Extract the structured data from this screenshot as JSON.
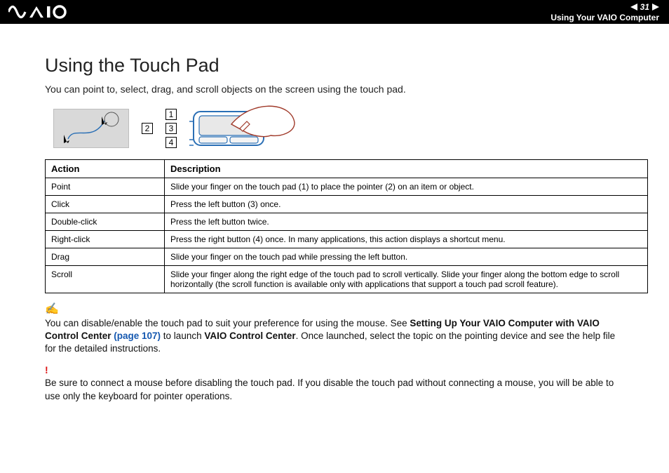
{
  "header": {
    "page_number": "31",
    "section": "Using Your VAIO Computer"
  },
  "title": "Using the Touch Pad",
  "intro": "You can point to, select, drag, and scroll objects on the screen using the touch pad.",
  "callouts": {
    "c1": "1",
    "c2": "2",
    "c3": "3",
    "c4": "4"
  },
  "table": {
    "headers": {
      "action": "Action",
      "description": "Description"
    },
    "rows": [
      {
        "action": "Point",
        "description": "Slide your finger on the touch pad (1) to place the pointer (2) on an item or object."
      },
      {
        "action": "Click",
        "description": "Press the left button (3) once."
      },
      {
        "action": "Double-click",
        "description": "Press the left button twice."
      },
      {
        "action": "Right-click",
        "description": "Press the right button (4) once. In many applications, this action displays a shortcut menu."
      },
      {
        "action": "Drag",
        "description": "Slide your finger on the touch pad while pressing the left button."
      },
      {
        "action": "Scroll",
        "description": "Slide your finger along the right edge of the touch pad to scroll vertically. Slide your finger along the bottom edge to scroll horizontally (the scroll function is available only with applications that support a touch pad scroll feature)."
      }
    ]
  },
  "note": {
    "pre": "You can disable/enable the touch pad to suit your preference for using the mouse. See ",
    "bold1": "Setting Up Your VAIO Computer with VAIO Control Center ",
    "link": "(page 107)",
    "mid": " to launch ",
    "bold2": "VAIO Control Center",
    "post": ". Once launched, select the topic on the pointing device and see the help file for the detailed instructions."
  },
  "warning": "Be sure to connect a mouse before disabling the touch pad. If you disable the touch pad without connecting a mouse, you will be able to use only the keyboard for pointer operations."
}
